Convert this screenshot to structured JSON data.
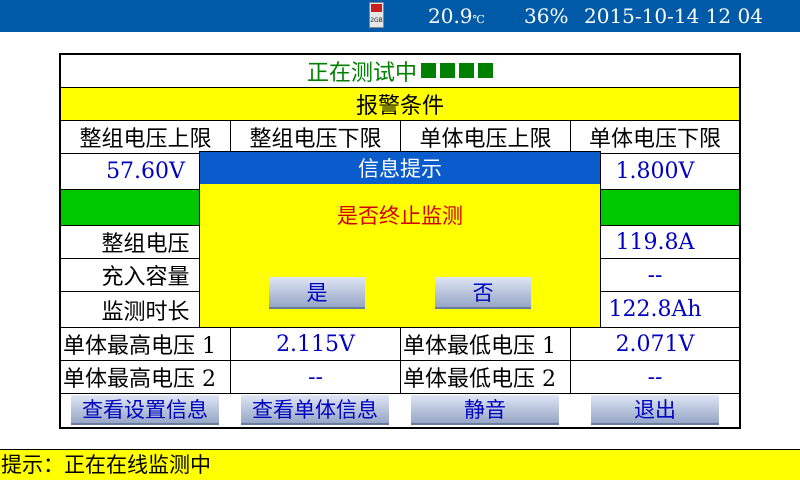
{
  "status_bar": {
    "sd_label": "2GB",
    "temperature": "20.9",
    "temperature_unit": "℃",
    "battery": "36%",
    "datetime": "2015-10-14 12 04"
  },
  "status_title": "正在测试中",
  "status_squares": 4,
  "alarm_section": {
    "title": "报警条件",
    "headers": [
      "整组电压上限",
      "整组电压下限",
      "单体电压上限",
      "单体电压下限"
    ],
    "values": [
      "57.60V",
      "",
      "",
      "1.800V"
    ]
  },
  "measurements": {
    "labels": [
      "整组电压",
      "充入容量",
      "监测时长"
    ],
    "right_values": [
      "119.8A",
      "--",
      "122.8Ah"
    ]
  },
  "cell_rows": [
    {
      "high_label": "单体最高电压 1",
      "high_value": "2.115V",
      "low_label": "单体最低电压 1",
      "low_value": "2.071V"
    },
    {
      "high_label": "单体最高电压 2",
      "high_value": "--",
      "low_label": "单体最低电压 2",
      "low_value": "--"
    }
  ],
  "buttons": {
    "view_settings": "查看设置信息",
    "view_cells": "查看单体信息",
    "mute": "静音",
    "exit": "退出"
  },
  "hint": {
    "prefix": "提示：",
    "text": "正在在线监测中"
  },
  "dialog": {
    "title": "信息提示",
    "message": "是否终止监测",
    "yes": "是",
    "no": "否"
  }
}
